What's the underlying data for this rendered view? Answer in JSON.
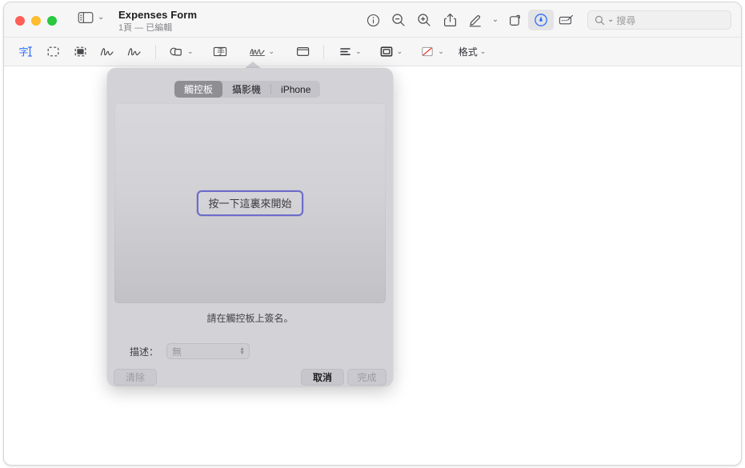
{
  "window": {
    "title": "Expenses Form",
    "subtitle": "1頁 — 已編輯",
    "traffic_lights": [
      "close",
      "minimize",
      "zoom"
    ]
  },
  "titlebar": {
    "sidebar_toggle": "sidebar-icon",
    "sidebar_chevron": "⌄",
    "buttons": [
      {
        "name": "info-icon",
        "label": "資訊"
      },
      {
        "name": "zoom-out-icon",
        "label": "縮小"
      },
      {
        "name": "zoom-in-icon",
        "label": "放大"
      },
      {
        "name": "share-icon",
        "label": "分享"
      },
      {
        "name": "highlight-icon",
        "label": "標示"
      },
      {
        "name": "chevron-down-icon",
        "label": "⌄"
      },
      {
        "name": "rotate-icon",
        "label": "旋轉"
      },
      {
        "name": "markup-icon",
        "label": "標示工具",
        "active": true
      },
      {
        "name": "signature-toolbar-icon",
        "label": "簽名檔"
      }
    ],
    "search": {
      "placeholder": "搜尋",
      "value": ""
    }
  },
  "markup_toolbar": {
    "items": [
      {
        "name": "text-select-icon",
        "label": "文字選取",
        "selected": true
      },
      {
        "name": "rect-select-icon",
        "label": "矩形選取"
      },
      {
        "name": "instant-alpha-icon",
        "label": "立即Alpha"
      },
      {
        "name": "sketch-icon",
        "label": "素描"
      },
      {
        "name": "draw-icon",
        "label": "繪圖"
      },
      {
        "name": "shapes-icon",
        "label": "形狀",
        "chevron": "⌄"
      },
      {
        "name": "text-box-icon",
        "label": "文字"
      },
      {
        "name": "sign-icon",
        "label": "簽名檔",
        "chevron": "⌄"
      },
      {
        "name": "note-icon",
        "label": "備忘錄"
      },
      {
        "name": "text-style-icon",
        "label": "文字樣式",
        "chevron": "⌄"
      },
      {
        "name": "border-style-icon",
        "label": "邊框樣式",
        "chevron": "⌄"
      },
      {
        "name": "fill-color-icon",
        "label": "填充顏色",
        "chevron": "⌄"
      },
      {
        "name": "format-menu",
        "label": "格式",
        "chevron": "⌄"
      }
    ]
  },
  "signature_popover": {
    "tabs": [
      {
        "label": "觸控板",
        "selected": true
      },
      {
        "label": "攝影機",
        "selected": false
      },
      {
        "label": "iPhone",
        "selected": false
      }
    ],
    "canvas": {
      "start_button_label": "按一下這裏來開始"
    },
    "hint": "請在觸控板上簽名。",
    "description": {
      "label": "描述：",
      "value": "無",
      "stepper": "stepper-icon"
    },
    "footer_buttons": [
      {
        "name": "clear-button",
        "label": "清除",
        "enabled": false
      },
      {
        "name": "cancel-button",
        "label": "取消",
        "enabled": true
      },
      {
        "name": "done-button",
        "label": "完成",
        "enabled": false
      }
    ]
  },
  "colors": {
    "accent_blue": "#2b6cf6",
    "focus_ring": "#6c6ccb",
    "popover_bg": "#d2d2d7",
    "segment_selected": "#8e8e93",
    "toolbar_bg": "#f6f6f6"
  }
}
